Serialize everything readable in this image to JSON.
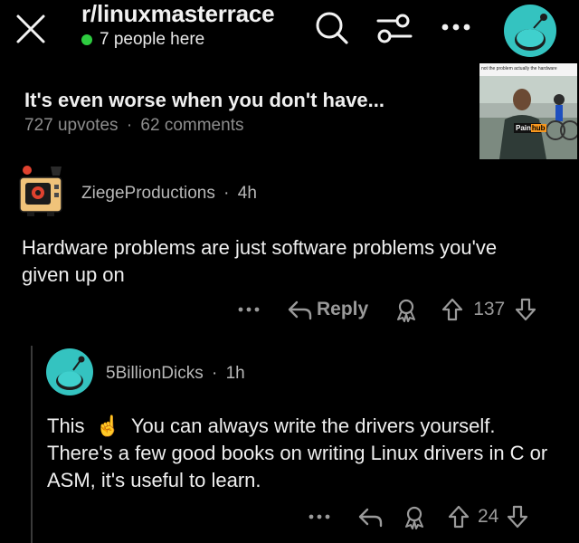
{
  "header": {
    "subreddit": "r/linuxmasterrace",
    "online_text": "7 people here"
  },
  "post": {
    "title": "It's even worse when you don't have...",
    "upvotes": "727 upvotes",
    "separator": "·",
    "comments": "62 comments",
    "thumbnail_caption": "not the problem actually the hardware",
    "thumbnail_shirt_text_left": "Pain",
    "thumbnail_shirt_text_right": "hub"
  },
  "comments": [
    {
      "author": "ZiegeProductions",
      "time": "4h",
      "body": "Hardware problems are just software problems you've given up on",
      "reply_label": "Reply",
      "score": "137"
    },
    {
      "author": "5BillionDicks",
      "time": "1h",
      "body_prefix": "This",
      "emoji": "☝",
      "body": "You can always write the drivers yourself. There's a few good books on writing Linux drivers in C or ASM, it's useful to learn.",
      "score": "24"
    }
  ],
  "icons": {
    "close": "close-icon",
    "search": "search-icon",
    "filter": "filter-icon",
    "more": "more-icon",
    "award": "award-icon",
    "upvote": "upvote-icon",
    "downvote": "downvote-icon",
    "reply": "reply-icon"
  },
  "colors": {
    "background": "#000000",
    "online_dot": "#2ecc40",
    "avatar_teal": "#34c3c0"
  }
}
